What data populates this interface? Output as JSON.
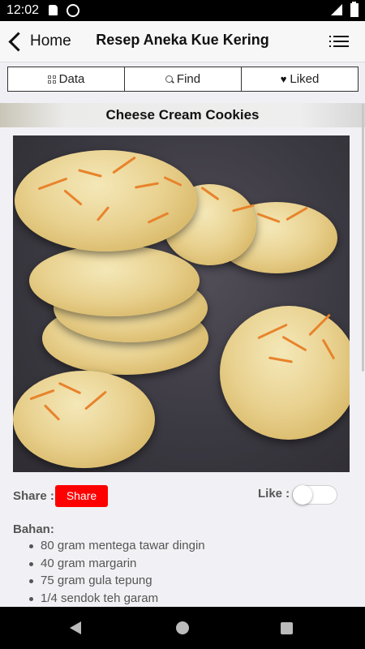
{
  "status_bar": {
    "time": "12:02",
    "icons": [
      "sd-card-icon",
      "sync-icon",
      "signal-icon",
      "battery-icon"
    ]
  },
  "nav": {
    "back_label": "Home",
    "title": "Resep Aneka Kue Kering",
    "menu_icon": "menu-list-icon"
  },
  "tabs": [
    {
      "label": "Data",
      "icon": "grid-icon"
    },
    {
      "label": "Find",
      "icon": "search-icon"
    },
    {
      "label": "Liked",
      "icon": "heart-icon"
    }
  ],
  "recipe": {
    "title": "Cheese Cream Cookies",
    "share_label": "Share :",
    "share_button": "Share",
    "like_label": "Like :",
    "like_on": false,
    "ingredients_title": "Bahan:",
    "ingredients": [
      "80 gram mentega tawar dingin",
      "40 gram margarin",
      "75 gram gula tepung",
      "1/4 sendok teh garam"
    ]
  },
  "colors": {
    "share_button": "#ff0000",
    "background": "#efeff4"
  }
}
